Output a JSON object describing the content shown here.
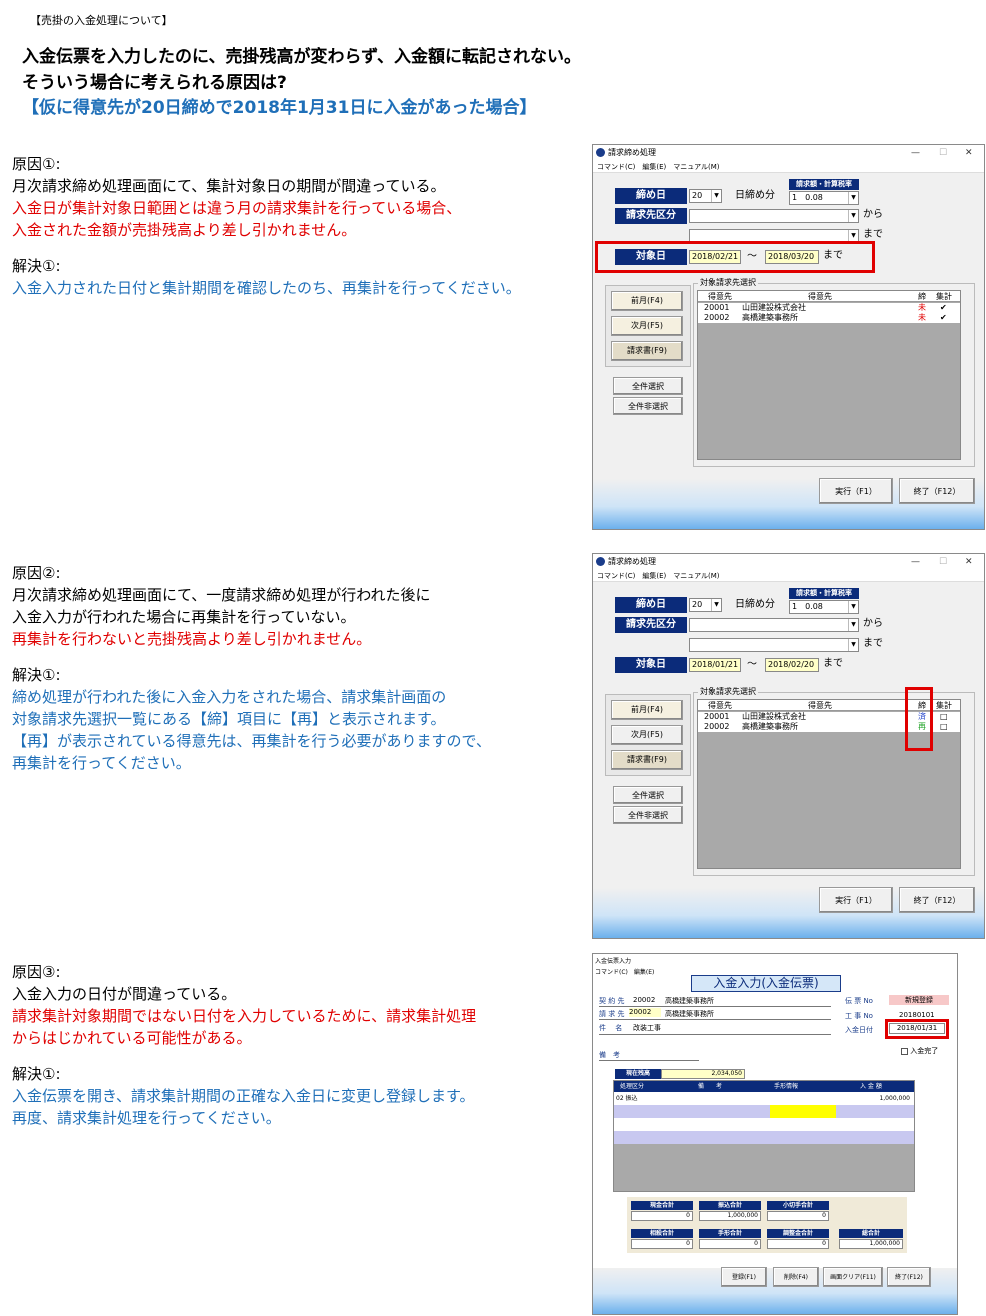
{
  "doc": {
    "bracket_title": "【売掛の入金処理について】",
    "headline1": "入金伝票を入力したのに、売掛残高が変わらず、入金額に転記されない。",
    "headline2": "そういう場合に考えられる原因は?",
    "headline3": "【仮に得意先が20日締めで2018年1月31日に入金があった場合】"
  },
  "sections": [
    {
      "cause_label": "原因①:",
      "cause_lines": [
        "月次請求締め処理画面にて、集計対象日の期間が間違っている。"
      ],
      "cause_red_lines": [
        "入金日が集計対象日範囲とは違う月の請求集計を行っている場合、",
        "入金された金額が売掛残高より差し引かれません。"
      ],
      "solution_label": "解決①:",
      "solution_lines": [
        "入金入力された日付と集計期間を確認したのち、再集計を行ってください。"
      ]
    },
    {
      "cause_label": "原因②:",
      "cause_lines": [
        "月次請求締め処理画面にて、一度請求締め処理が行われた後に",
        "入金入力が行われた場合に再集計を行っていない。"
      ],
      "cause_red_lines": [
        "再集計を行わないと売掛残高より差し引かれません。"
      ],
      "solution_label": "解決①:",
      "solution_lines": [
        "締め処理が行われた後に入金入力をされた場合、請求集計画面の",
        "対象請求先選択一覧にある【締】項目に【再】と表示されます。",
        "【再】が表示されている得意先は、再集計を行う必要がありますので、",
        "再集計を行ってください。"
      ]
    },
    {
      "cause_label": "原因③:",
      "cause_lines": [
        "入金入力の日付が間違っている。"
      ],
      "cause_red_lines": [
        "請求集計対象期間ではない日付を入力しているために、請求集計処理",
        "からはじかれている可能性がある。"
      ],
      "solution_label": "解決①:",
      "solution_lines": [
        "入金伝票を開き、請求集計期間の正確な入金日に変更し登録します。",
        "再度、請求集計処理を行ってください。"
      ]
    }
  ],
  "win1": {
    "title": "請求締め処理",
    "menu": "コマンド(C)　編集(E)　マニュアル(M)",
    "shime_label": "締め日",
    "shime_value": "20",
    "shime_suffix": "日締め分",
    "rate_label": "請求額・計算税率",
    "rate_value": "1　0.08",
    "kubun_label": "請求先区分",
    "kara": "から",
    "made": "まで",
    "target_label": "対象日",
    "date_from": "2018/02/21",
    "tilde": "～",
    "date_to": "2018/03/20",
    "date_made": "まで",
    "group_title": "対象請求先選択",
    "col_code": "得意先",
    "col_name": "得意先",
    "col_shime": "締",
    "col_sum": "集計",
    "rows": [
      {
        "code": "20001",
        "name": "山田建設株式会社",
        "shime": "未",
        "sum": "✔"
      },
      {
        "code": "20002",
        "name": "高橋建築事務所",
        "shime": "未",
        "sum": "✔"
      }
    ],
    "btn_prev": "前月(F4)",
    "btn_next": "次月(F5)",
    "btn_invoice": "請求書(F9)",
    "btn_all": "全件選択",
    "btn_none": "全件非選択",
    "btn_run": "実行（F1）",
    "btn_end": "終了（F12）"
  },
  "win2": {
    "title": "請求締め処理",
    "menu": "コマンド(C)　編集(E)　マニュアル(M)",
    "shime_label": "締め日",
    "shime_value": "20",
    "shime_suffix": "日締め分",
    "rate_label": "請求額・計算税率",
    "rate_value": "1　0.08",
    "kubun_label": "請求先区分",
    "kara": "から",
    "made": "まで",
    "target_label": "対象日",
    "date_from": "2018/01/21",
    "tilde": "～",
    "date_to": "2018/02/20",
    "date_made": "まで",
    "group_title": "対象請求先選択",
    "col_code": "得意先",
    "col_name": "得意先",
    "col_shime": "締",
    "col_sum": "集計",
    "rows": [
      {
        "code": "20001",
        "name": "山田建設株式会社",
        "shime": "済",
        "sum": "□"
      },
      {
        "code": "20002",
        "name": "高橋建築事務所",
        "shime": "再",
        "sum": "□"
      }
    ],
    "btn_prev": "前月(F4)",
    "btn_next": "次月(F5)",
    "btn_invoice": "請求書(F9)",
    "btn_all": "全件選択",
    "btn_none": "全件非選択",
    "btn_run": "実行（F1）",
    "btn_end": "終了（F12）"
  },
  "win3": {
    "title": "入金伝票入力",
    "menu": "コマンド(C)　編集(E)",
    "heading": "入金入力(入金伝票)",
    "keiyaku_label": "契 約 先",
    "keiyaku_code": "20002",
    "keiyaku_name": "高橋建築事務所",
    "seikyu_label": "請 求 先",
    "seikyu_code": "20002",
    "seikyu_name": "高橋建築事務所",
    "kenmei_label": "件　 名",
    "kenmei_value": "改装工事",
    "biko_label": "備　考",
    "denpyo_label": "伝 票 No",
    "denpyo_value": "新規登録",
    "koji_label": "工 事 No",
    "koji_value": "20180101",
    "date_label": "入金日付",
    "date_value": "2018/01/31",
    "kanryo": "入金完了",
    "zandaka_label": "現在残高",
    "zandaka_value": "2,034,050",
    "col1": "処理区分",
    "col2": "備　　考",
    "col3": "手形情報",
    "col4": "入 金 額",
    "row1_kubun": "02 振込",
    "row1_amount": "1,000,000",
    "sum_genkin": "現金合計",
    "sum_genkin_v": "0",
    "sum_furikomi": "振込合計",
    "sum_furikomi_v": "1,000,000",
    "sum_kogitte": "小切手合計",
    "sum_kogitte_v": "0",
    "sum_sousai": "相殺合計",
    "sum_sousai_v": "0",
    "sum_tegata": "手形合計",
    "sum_tegata_v": "0",
    "sum_chosei": "調整金合計",
    "sum_chosei_v": "0",
    "sum_total": "総合計",
    "sum_total_v": "1,000,000",
    "btn_save": "登録(F1)",
    "btn_del": "削除(F4)",
    "btn_clear": "画面クリア(F11)",
    "btn_end": "終了(F12)"
  }
}
